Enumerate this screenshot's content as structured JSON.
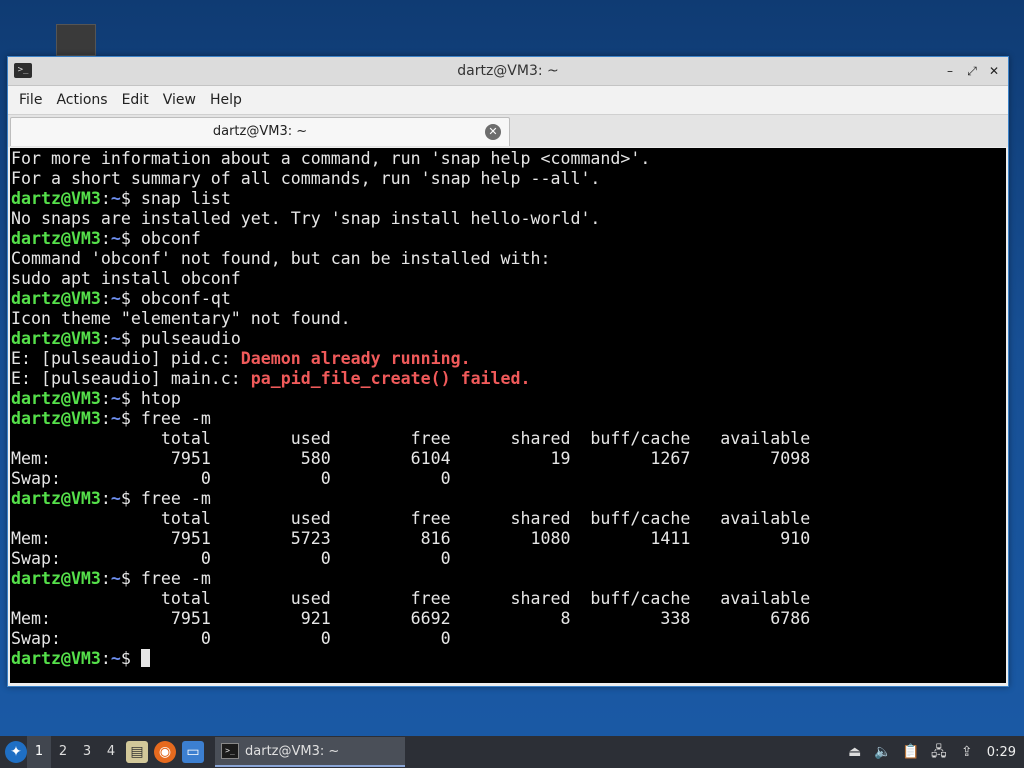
{
  "window": {
    "title": "dartz@VM3: ~",
    "controls": {
      "minimize": "–",
      "maximize": "⤢",
      "close": "✕"
    }
  },
  "menu": [
    "File",
    "Actions",
    "Edit",
    "View",
    "Help"
  ],
  "tab": {
    "label": "dartz@VM3: ~",
    "close": "✕"
  },
  "prompt": {
    "user": "dartz@VM3",
    "sep": ":",
    "path": "~",
    "sigil": "$"
  },
  "terminal_lines": [
    {
      "t": "out",
      "text": "For more information about a command, run 'snap help <command>'."
    },
    {
      "t": "out",
      "text": "For a short summary of all commands, run 'snap help --all'."
    },
    {
      "t": "cmd",
      "text": " snap list"
    },
    {
      "t": "out",
      "text": "No snaps are installed yet. Try 'snap install hello-world'."
    },
    {
      "t": "cmd",
      "text": " obconf"
    },
    {
      "t": "out",
      "text": "Command 'obconf' not found, but can be installed with:"
    },
    {
      "t": "out",
      "text": "sudo apt install obconf"
    },
    {
      "t": "cmd",
      "text": " obconf-qt"
    },
    {
      "t": "out",
      "text": "Icon theme \"elementary\" not found."
    },
    {
      "t": "cmd",
      "text": " pulseaudio"
    },
    {
      "t": "err",
      "text": "E: [pulseaudio] pid.c: ",
      "err": "Daemon already running."
    },
    {
      "t": "err",
      "text": "E: [pulseaudio] main.c: ",
      "err": "pa_pid_file_create() failed."
    },
    {
      "t": "cmd",
      "text": " htop"
    },
    {
      "t": "cmd",
      "text": " free -m"
    },
    {
      "t": "out",
      "text": "               total        used        free      shared  buff/cache   available"
    },
    {
      "t": "out",
      "text": "Mem:            7951         580        6104          19        1267        7098"
    },
    {
      "t": "out",
      "text": "Swap:              0           0           0"
    },
    {
      "t": "cmd",
      "text": " free -m"
    },
    {
      "t": "out",
      "text": "               total        used        free      shared  buff/cache   available"
    },
    {
      "t": "out",
      "text": "Mem:            7951        5723         816        1080        1411         910"
    },
    {
      "t": "out",
      "text": "Swap:              0           0           0"
    },
    {
      "t": "cmd",
      "text": " free -m"
    },
    {
      "t": "out",
      "text": "               total        used        free      shared  buff/cache   available"
    },
    {
      "t": "out",
      "text": "Mem:            7951         921        6692           8         338        6786"
    },
    {
      "t": "out",
      "text": "Swap:              0           0           0"
    },
    {
      "t": "prompt",
      "text": " "
    }
  ],
  "taskbar": {
    "workspaces": [
      "1",
      "2",
      "3",
      "4"
    ],
    "active_workspace": "1",
    "launchers": [
      "file-manager-icon",
      "firefox-icon",
      "desktop-icon"
    ],
    "task_label": "dartz@VM3: ~",
    "tray_icons": [
      "eject-icon",
      "volume-icon",
      "clipboard-icon",
      "network-icon",
      "update-icon"
    ],
    "clock": "0:29"
  },
  "colors": {
    "prompt_user": "#55e04a",
    "prompt_path": "#6e8ff0",
    "error": "#f05a5a",
    "terminal_bg": "#000000"
  }
}
